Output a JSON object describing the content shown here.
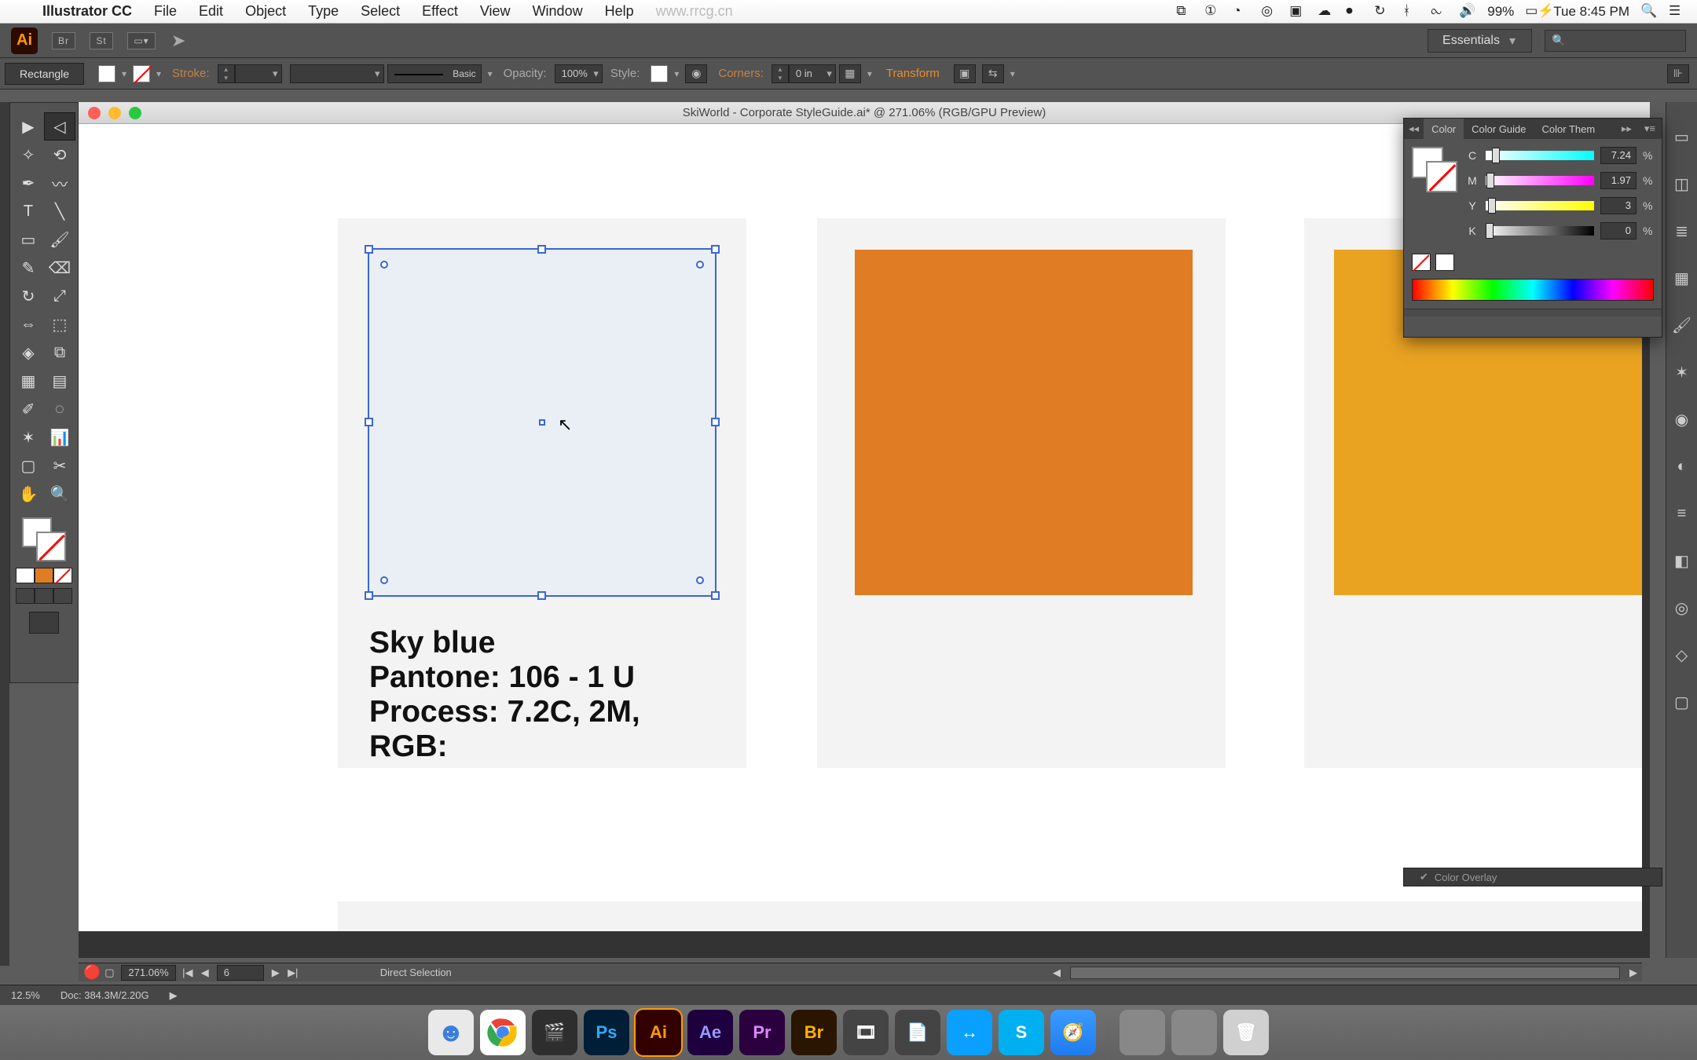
{
  "menubar": {
    "app": "Illustrator CC",
    "items": [
      "File",
      "Edit",
      "Object",
      "Type",
      "Select",
      "Effect",
      "View",
      "Window",
      "Help"
    ],
    "watermark": "www.rrcg.cn",
    "battery": "99%",
    "clock": "Tue 8:45 PM"
  },
  "app_top": {
    "workspace": "Essentials",
    "search_placeholder": ""
  },
  "control": {
    "tool_label": "Rectangle",
    "stroke_label": "Stroke:",
    "brush_label": "Basic",
    "opacity_label": "Opacity:",
    "opacity_value": "100%",
    "style_label": "Style:",
    "corners_label": "Corners:",
    "corners_value": "0 in",
    "transform_label": "Transform"
  },
  "titlebar": {
    "title": "SkiWorld - Corporate StyleGuide.ai* @ 271.06% (RGB/GPU Preview)"
  },
  "canvas": {
    "swatch1": {
      "name": "Sky blue",
      "pantone": "Pantone: 106 - 1 U",
      "process": "Process: 7.2C, 2M,",
      "rgb": "RGB:",
      "color": "#e9eff4"
    },
    "swatch2_color": "#e07c24",
    "swatch3_color": "#eaa321"
  },
  "doc_status": {
    "zoom": "271.06%",
    "artboard": "6",
    "mode": "Direct Selection"
  },
  "app_footer": {
    "zoom": "12.5%",
    "doc": "Doc: 384.3M/2.20G"
  },
  "color_panel": {
    "tabs": [
      "Color",
      "Color Guide",
      "Color Them"
    ],
    "c_label": "C",
    "c_val": "7.24",
    "m_label": "M",
    "m_val": "1.97",
    "y_label": "Y",
    "y_val": "3",
    "k_label": "K",
    "k_val": "0"
  },
  "right_overlay": "Color Overlay",
  "dock": [
    {
      "label": "",
      "bg": "#e9e9e9"
    },
    {
      "label": "",
      "bg": "#ffffff"
    },
    {
      "label": "",
      "bg": "#2e2e2e"
    },
    {
      "label": "Ps",
      "bg": "#001e36",
      "fg": "#31a8ff"
    },
    {
      "label": "Ai",
      "bg": "#330000",
      "fg": "#ff9a00"
    },
    {
      "label": "Ae",
      "bg": "#1f003f",
      "fg": "#9999ff"
    },
    {
      "label": "Pr",
      "bg": "#2a003f",
      "fg": "#e085ff"
    },
    {
      "label": "Br",
      "bg": "#2a1500",
      "fg": "#ffb400"
    },
    {
      "label": "",
      "bg": "#444"
    },
    {
      "label": "",
      "bg": "#444"
    },
    {
      "label": "",
      "bg": "#0aa0ff"
    },
    {
      "label": "S",
      "bg": "#00aff0"
    },
    {
      "label": "",
      "bg": "#1f7cf0"
    },
    {
      "label": "",
      "bg": "#888"
    },
    {
      "label": "",
      "bg": "#888"
    },
    {
      "label": "",
      "bg": "#d0d0d0"
    }
  ]
}
